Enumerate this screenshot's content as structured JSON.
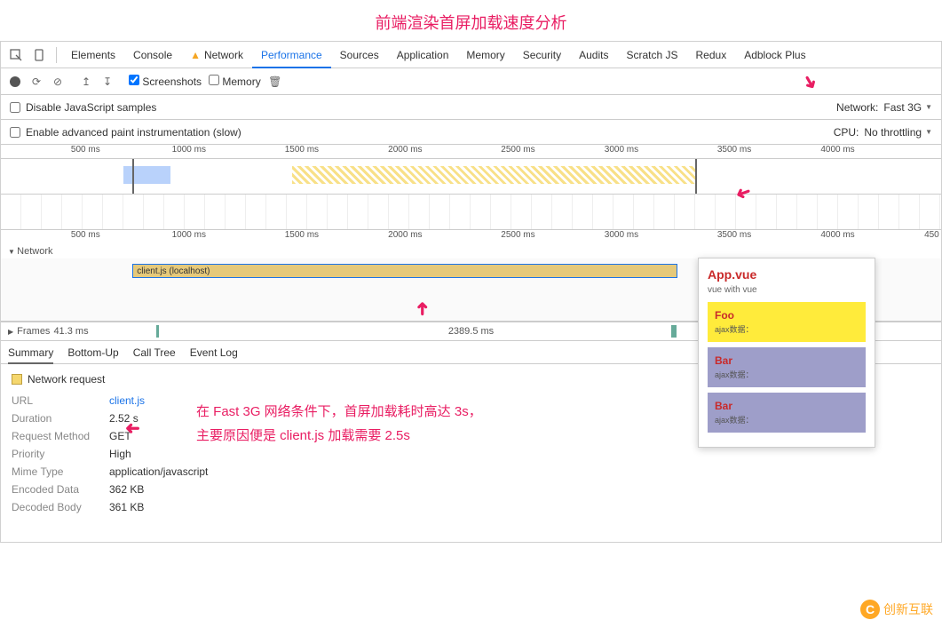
{
  "annotations": {
    "title": "前端渲染首屏加载速度分析",
    "body_line1": "在 Fast 3G 网络条件下，首屏加载耗时高达 3s，",
    "body_line2": "主要原因便是 client.js 加载需要 2.5s"
  },
  "tabs": [
    "Elements",
    "Console",
    "Network",
    "Performance",
    "Sources",
    "Application",
    "Memory",
    "Security",
    "Audits",
    "Scratch JS",
    "Redux",
    "Adblock Plus"
  ],
  "active_tab": "Performance",
  "warn_tab": "Network",
  "toolbar2": {
    "screenshots": "Screenshots",
    "memory": "Memory"
  },
  "options": {
    "disable_js": "Disable JavaScript samples",
    "enable_paint": "Enable advanced paint instrumentation (slow)",
    "network_label": "Network:",
    "network_value": "Fast 3G",
    "cpu_label": "CPU:",
    "cpu_value": "No throttling"
  },
  "timeline": {
    "ticks": [
      "500 ms",
      "1000 ms",
      "1500 ms",
      "2000 ms",
      "2500 ms",
      "3000 ms",
      "3500 ms",
      "4000 ms"
    ],
    "ticks2": [
      "500 ms",
      "1000 ms",
      "1500 ms",
      "2000 ms",
      "2500 ms",
      "3000 ms",
      "3500 ms",
      "4000 ms",
      "450"
    ]
  },
  "network": {
    "label": "Network",
    "request": "client.js (localhost)"
  },
  "frames": {
    "label": "Frames",
    "short": "41.3 ms",
    "long": "2389.5 ms"
  },
  "detail_tabs": [
    "Summary",
    "Bottom-Up",
    "Call Tree",
    "Event Log"
  ],
  "summary": {
    "title": "Network request",
    "url_k": "URL",
    "url_v": "client.js",
    "duration_k": "Duration",
    "duration_v": "2.52 s",
    "method_k": "Request Method",
    "method_v": "GET",
    "priority_k": "Priority",
    "priority_v": "High",
    "mime_k": "Mime Type",
    "mime_v": "application/javascript",
    "encoded_k": "Encoded Data",
    "encoded_v": "362 KB",
    "decoded_k": "Decoded Body",
    "decoded_v": "361 KB"
  },
  "preview": {
    "title": "App.vue",
    "subtitle": "vue with vue",
    "blocks": [
      {
        "name": "Foo",
        "label": "ajax数据："
      },
      {
        "name": "Bar",
        "label": "ajax数据："
      },
      {
        "name": "Bar",
        "label": "ajax数据："
      }
    ]
  },
  "logo": "创新互联"
}
